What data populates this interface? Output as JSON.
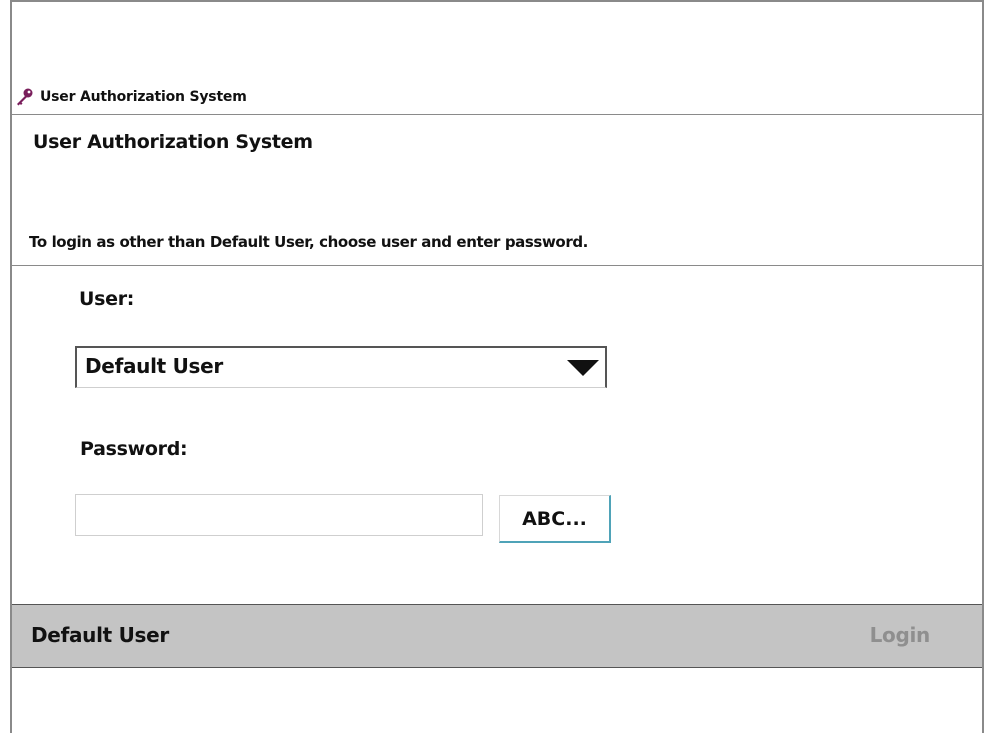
{
  "window": {
    "title": "User Authorization System",
    "icon": "key-icon",
    "icon_color": "#7a1f5c"
  },
  "header": {
    "heading": "User Authorization System",
    "instructions": "To login as other than Default User, choose user and enter password."
  },
  "form": {
    "user_label": "User:",
    "user_selected": "Default User",
    "password_label": "Password:",
    "password_value": "",
    "password_placeholder": "",
    "keyboard_button_label": "ABC..."
  },
  "statusbar": {
    "current_user": "Default User",
    "login_label": "Login",
    "login_enabled": false,
    "background": "#c4c4c4"
  },
  "colors": {
    "button_accent": "#4fa3b8",
    "disabled_text": "#8f8f8f"
  }
}
